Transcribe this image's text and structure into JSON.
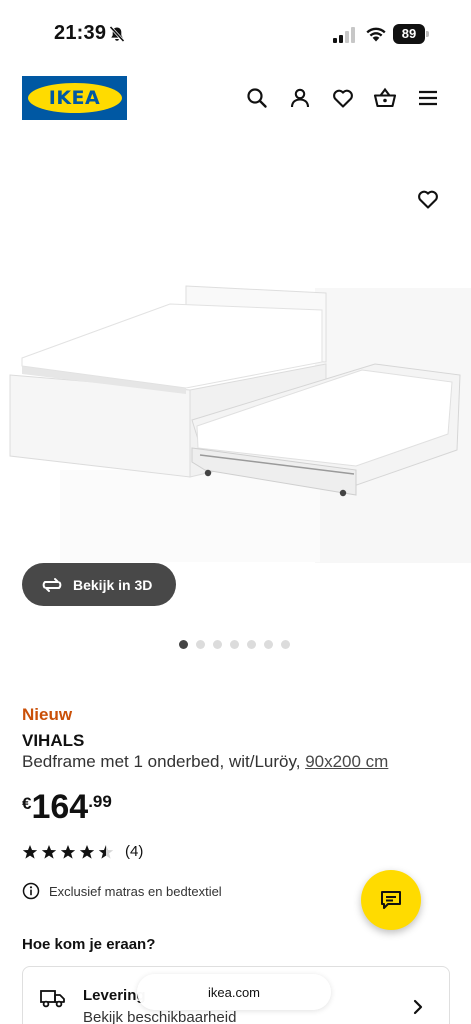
{
  "status_bar": {
    "time": "21:39",
    "battery": "89"
  },
  "header": {
    "logo_text": "IKEA",
    "icons": [
      "search-icon",
      "user-icon",
      "heart-icon",
      "basket-icon",
      "menu-icon"
    ]
  },
  "gallery": {
    "view3d_label": "Bekijk in 3D",
    "dots_total": 7,
    "active_dot": 1
  },
  "product": {
    "badge": "Nieuw",
    "name": "VIHALS",
    "description": "Bedframe met 1 onderbed, wit/Luröy,",
    "size": "90x200 cm",
    "price_currency": "€",
    "price_integer": "164",
    "price_decimal": ".99",
    "rating_value": 4.5,
    "rating_max": 5,
    "rating_count": "(4)",
    "note": "Exclusief matras en bedtextiel"
  },
  "delivery": {
    "section_title": "Hoe kom je eraan?",
    "title": "Levering",
    "subtitle": "Bekijk beschikbaarheid"
  },
  "browser": {
    "url": "ikea.com"
  },
  "colors": {
    "brand_blue": "#0058a3",
    "brand_yellow": "#ffdb00",
    "new_badge": "#ca5008",
    "button_dark": "#484848"
  }
}
